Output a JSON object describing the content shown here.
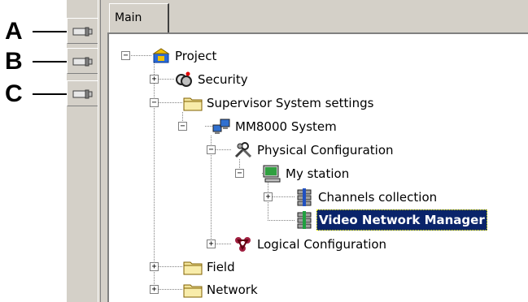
{
  "callouts": [
    "A",
    "B",
    "C"
  ],
  "strip": {
    "buttons": [
      {
        "icon": "camera-icon"
      },
      {
        "icon": "camera-icon"
      },
      {
        "icon": "camera-icon"
      }
    ]
  },
  "tab": {
    "label": "Main"
  },
  "tree": {
    "project": {
      "label": "Project",
      "expander": "−"
    },
    "security": {
      "label": "Security",
      "expander": "+"
    },
    "supervisor": {
      "label": "Supervisor System settings",
      "expander": "−"
    },
    "mm8000": {
      "label": "MM8000 System",
      "expander": "−"
    },
    "physical": {
      "label": "Physical Configuration",
      "expander": "−"
    },
    "mystation": {
      "label": "My station",
      "expander": "−"
    },
    "channels": {
      "label": "Channels collection",
      "expander": "+"
    },
    "vnm": {
      "label": "Video Network Manager"
    },
    "logical": {
      "label": "Logical Configuration",
      "expander": "+"
    },
    "field": {
      "label": "Field",
      "expander": "+"
    },
    "network": {
      "label": "Network",
      "expander": "+"
    }
  },
  "colors": {
    "selection": "#0a246a",
    "panel": "#d4d0c8",
    "folder": "#f2e49b"
  }
}
